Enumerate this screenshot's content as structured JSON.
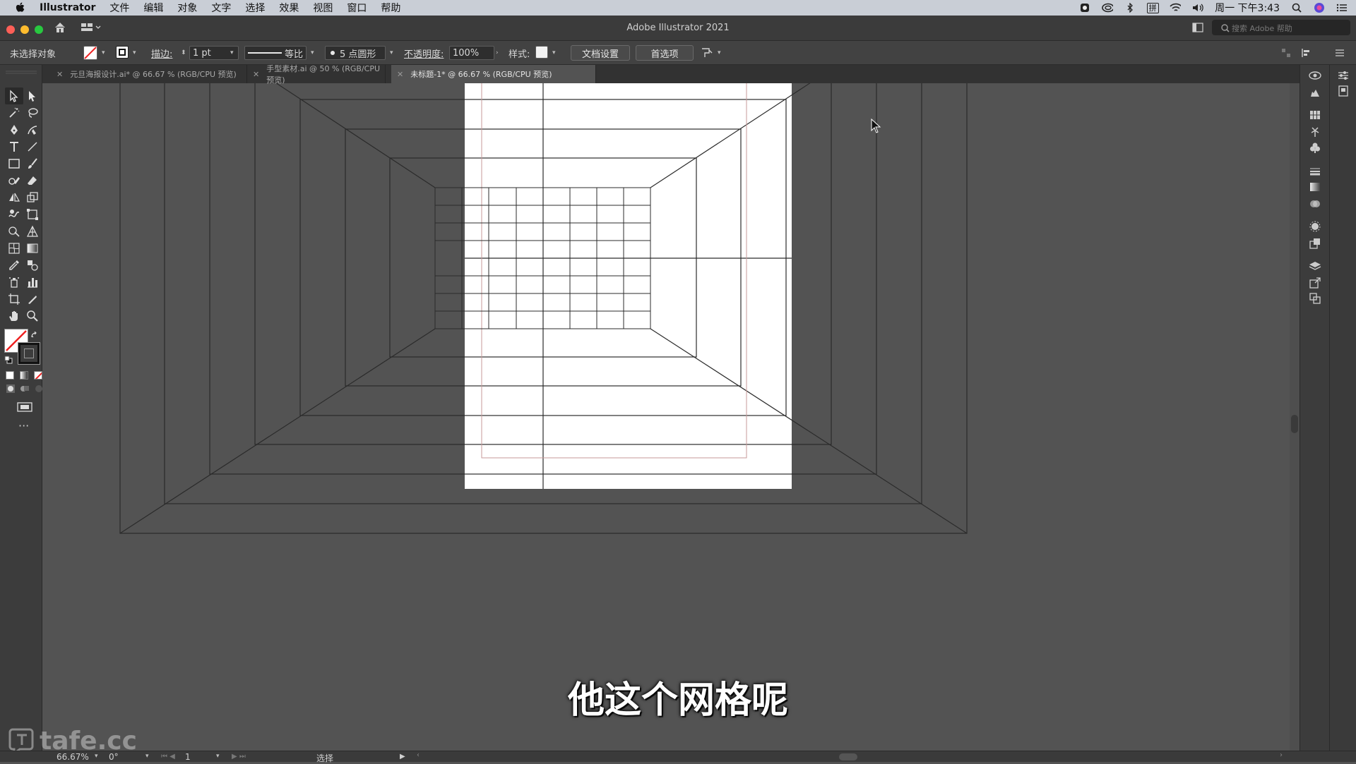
{
  "menubar": {
    "app": "Illustrator",
    "items": [
      "文件",
      "编辑",
      "对象",
      "文字",
      "选择",
      "效果",
      "视图",
      "窗口",
      "帮助"
    ],
    "clock": "周一 下午3:43",
    "ime": "拼"
  },
  "window": {
    "title": "Adobe Illustrator 2021",
    "help_search_placeholder": "搜索 Adobe 帮助"
  },
  "controlbar": {
    "selection_state": "未选择对象",
    "stroke_label": "描边:",
    "stroke_weight": "1 pt",
    "stroke_profile": "等比",
    "brush": "5 点圆形",
    "opacity_label": "不透明度:",
    "opacity_value": "100%",
    "style_label": "样式:",
    "doc_setup_button": "文档设置",
    "preferences_button": "首选项"
  },
  "tabs": [
    {
      "label": "元旦海报设计.ai* @ 66.67 % (RGB/CPU 预览)",
      "active": false
    },
    {
      "label": "手型素材.ai @ 50 % (RGB/CPU 预览)",
      "active": false
    },
    {
      "label": "未标题-1* @ 66.67 % (RGB/CPU 预览)",
      "active": true
    }
  ],
  "subtitle": "他这个网格呢",
  "watermark": "tafe.cc",
  "statusbar": {
    "zoom": "66.67%",
    "rotation": "0°",
    "artboard": "1",
    "tool": "选择"
  },
  "colors": {
    "pasteboard": "#535353",
    "artboard": "#ffffff",
    "grid_line": "#2b2b2b",
    "margin_guide": "#c79a98"
  }
}
